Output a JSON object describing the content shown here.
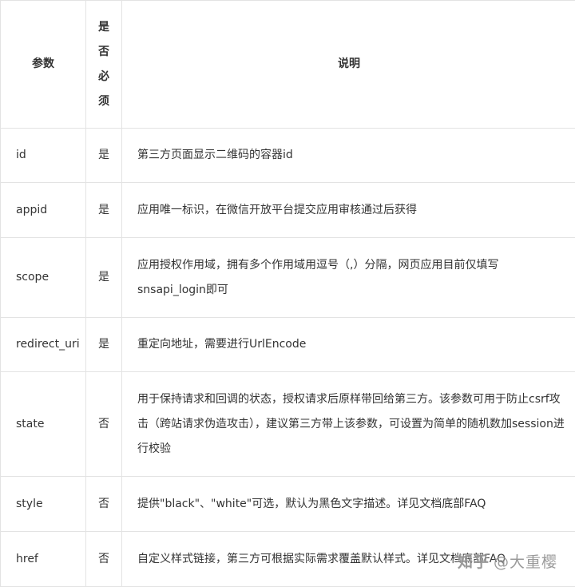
{
  "table": {
    "headers": {
      "param": "参数",
      "required": "是否必须",
      "description": "说明"
    },
    "rows": [
      {
        "param": "id",
        "required": "是",
        "description": "第三方页面显示二维码的容器id"
      },
      {
        "param": "appid",
        "required": "是",
        "description": "应用唯一标识，在微信开放平台提交应用审核通过后获得"
      },
      {
        "param": "scope",
        "required": "是",
        "description": "应用授权作用域，拥有多个作用域用逗号（,）分隔，网页应用目前仅填写snsapi_login即可"
      },
      {
        "param": "redirect_uri",
        "required": "是",
        "description": "重定向地址，需要进行UrlEncode"
      },
      {
        "param": "state",
        "required": "否",
        "description": "用于保持请求和回调的状态，授权请求后原样带回给第三方。该参数可用于防止csrf攻击（跨站请求伪造攻击），建议第三方带上该参数，可设置为简单的随机数加session进行校验"
      },
      {
        "param": "style",
        "required": "否",
        "description": "提供\"black\"、\"white\"可选，默认为黑色文字描述。详见文档底部FAQ"
      },
      {
        "param": "href",
        "required": "否",
        "description": "自定义样式链接，第三方可根据实际需求覆盖默认样式。详见文档底部FAQ"
      }
    ]
  },
  "watermark": {
    "brand": "知乎",
    "handle": "@大重樱"
  }
}
